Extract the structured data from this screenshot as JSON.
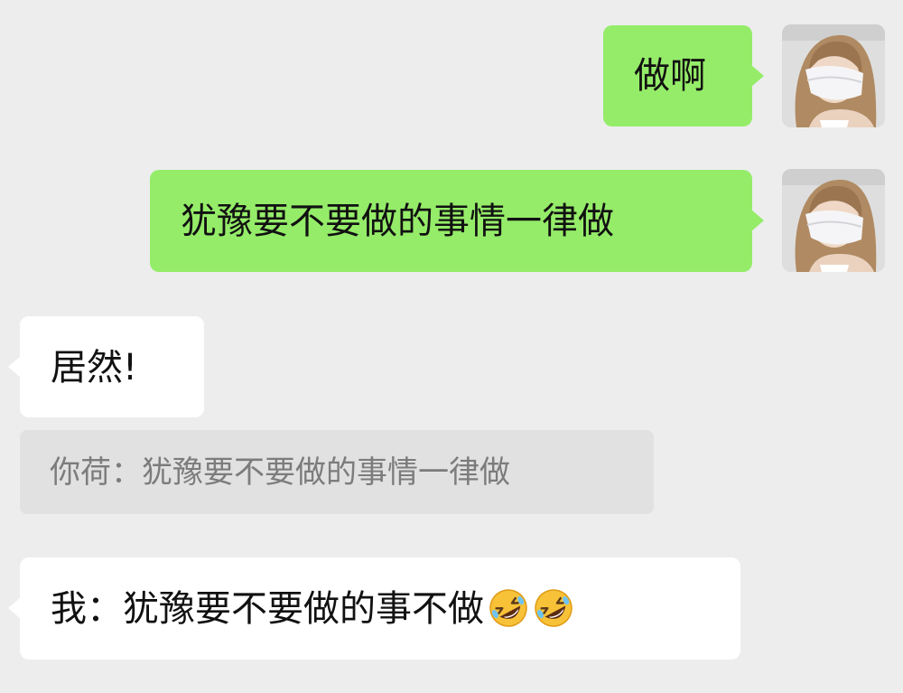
{
  "messages": [
    {
      "sender": "me",
      "text": "做啊"
    },
    {
      "sender": "me",
      "text": "犹豫要不要做的事情一律做"
    },
    {
      "sender": "other",
      "text": "居然!"
    },
    {
      "sender": "other",
      "quote": "你荷：犹豫要不要做的事情一律做"
    },
    {
      "sender": "other",
      "text": "我：犹豫要不要做的事不做",
      "emoji": [
        "rolling-on-floor-laughing",
        "rolling-on-floor-laughing"
      ]
    }
  ],
  "avatars": {
    "me": "woman-face-mask-photo"
  },
  "colors": {
    "background": "#ededed",
    "outgoing_bubble": "#95ec69",
    "incoming_bubble": "#ffffff",
    "quote_background": "#e1e1e1",
    "quote_text": "#7c7c7c"
  }
}
